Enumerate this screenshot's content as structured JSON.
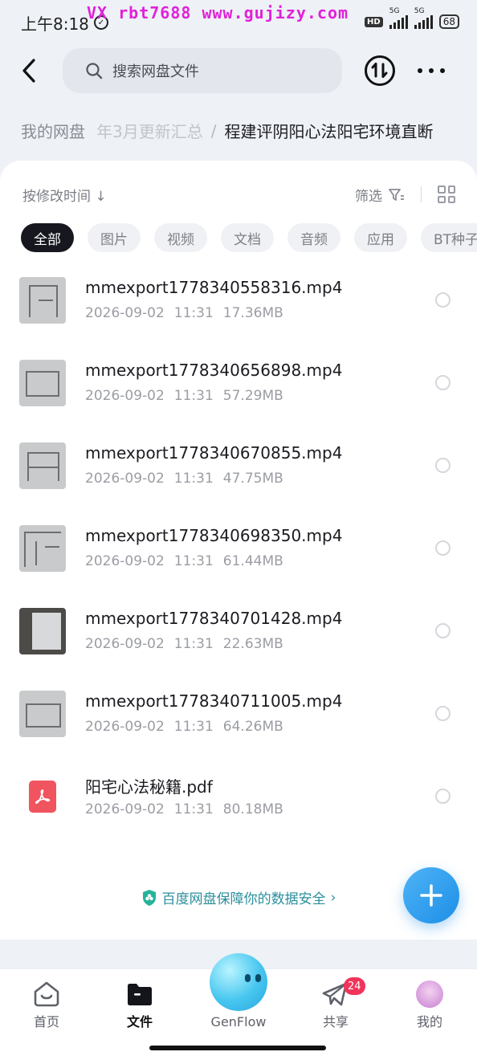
{
  "status_bar": {
    "time": "上午8:18",
    "watermark": "VX  rbt7688   www.gujizy.com",
    "hd_label": "HD",
    "network_1": "5G",
    "network_2": "5G",
    "battery": "68"
  },
  "topbar": {
    "search_placeholder": "搜索网盘文件"
  },
  "breadcrumb": {
    "root": "我的网盘",
    "middle": "年3月更新汇总",
    "separator": "/",
    "current": "程建评阴阳心法阳宅环境直断"
  },
  "toolbar": {
    "sort_label": "按修改时间 ↓",
    "filter_label": "筛选"
  },
  "chips": [
    {
      "label": "全部",
      "active": true
    },
    {
      "label": "图片",
      "active": false
    },
    {
      "label": "视频",
      "active": false
    },
    {
      "label": "文档",
      "active": false
    },
    {
      "label": "音频",
      "active": false
    },
    {
      "label": "应用",
      "active": false
    },
    {
      "label": "BT种子",
      "active": false
    }
  ],
  "files": [
    {
      "name": "mmexport1778340558316.mp4",
      "date": "2026-09-02",
      "time": "11:31",
      "size": "17.36MB",
      "type": "video"
    },
    {
      "name": "mmexport1778340656898.mp4",
      "date": "2026-09-02",
      "time": "11:31",
      "size": "57.29MB",
      "type": "video"
    },
    {
      "name": "mmexport1778340670855.mp4",
      "date": "2026-09-02",
      "time": "11:31",
      "size": "47.75MB",
      "type": "video"
    },
    {
      "name": "mmexport1778340698350.mp4",
      "date": "2026-09-02",
      "time": "11:31",
      "size": "61.44MB",
      "type": "video"
    },
    {
      "name": "mmexport1778340701428.mp4",
      "date": "2026-09-02",
      "time": "11:31",
      "size": "22.63MB",
      "type": "video"
    },
    {
      "name": "mmexport1778340711005.mp4",
      "date": "2026-09-02",
      "time": "11:31",
      "size": "64.26MB",
      "type": "video"
    },
    {
      "name": "阳宅心法秘籍.pdf",
      "date": "2026-09-02",
      "time": "11:31",
      "size": "80.18MB",
      "type": "pdf"
    }
  ],
  "safety_notice": "百度网盘保障你的数据安全",
  "tabbar": {
    "home": "首页",
    "files": "文件",
    "genflow": "GenFlow",
    "share": "共享",
    "share_badge": "24",
    "me": "我的"
  },
  "colors": {
    "accent": "#1d8fe6",
    "badge": "#f2335a",
    "pdf": "#f0545f",
    "safety_text": "#2b8f9c"
  }
}
